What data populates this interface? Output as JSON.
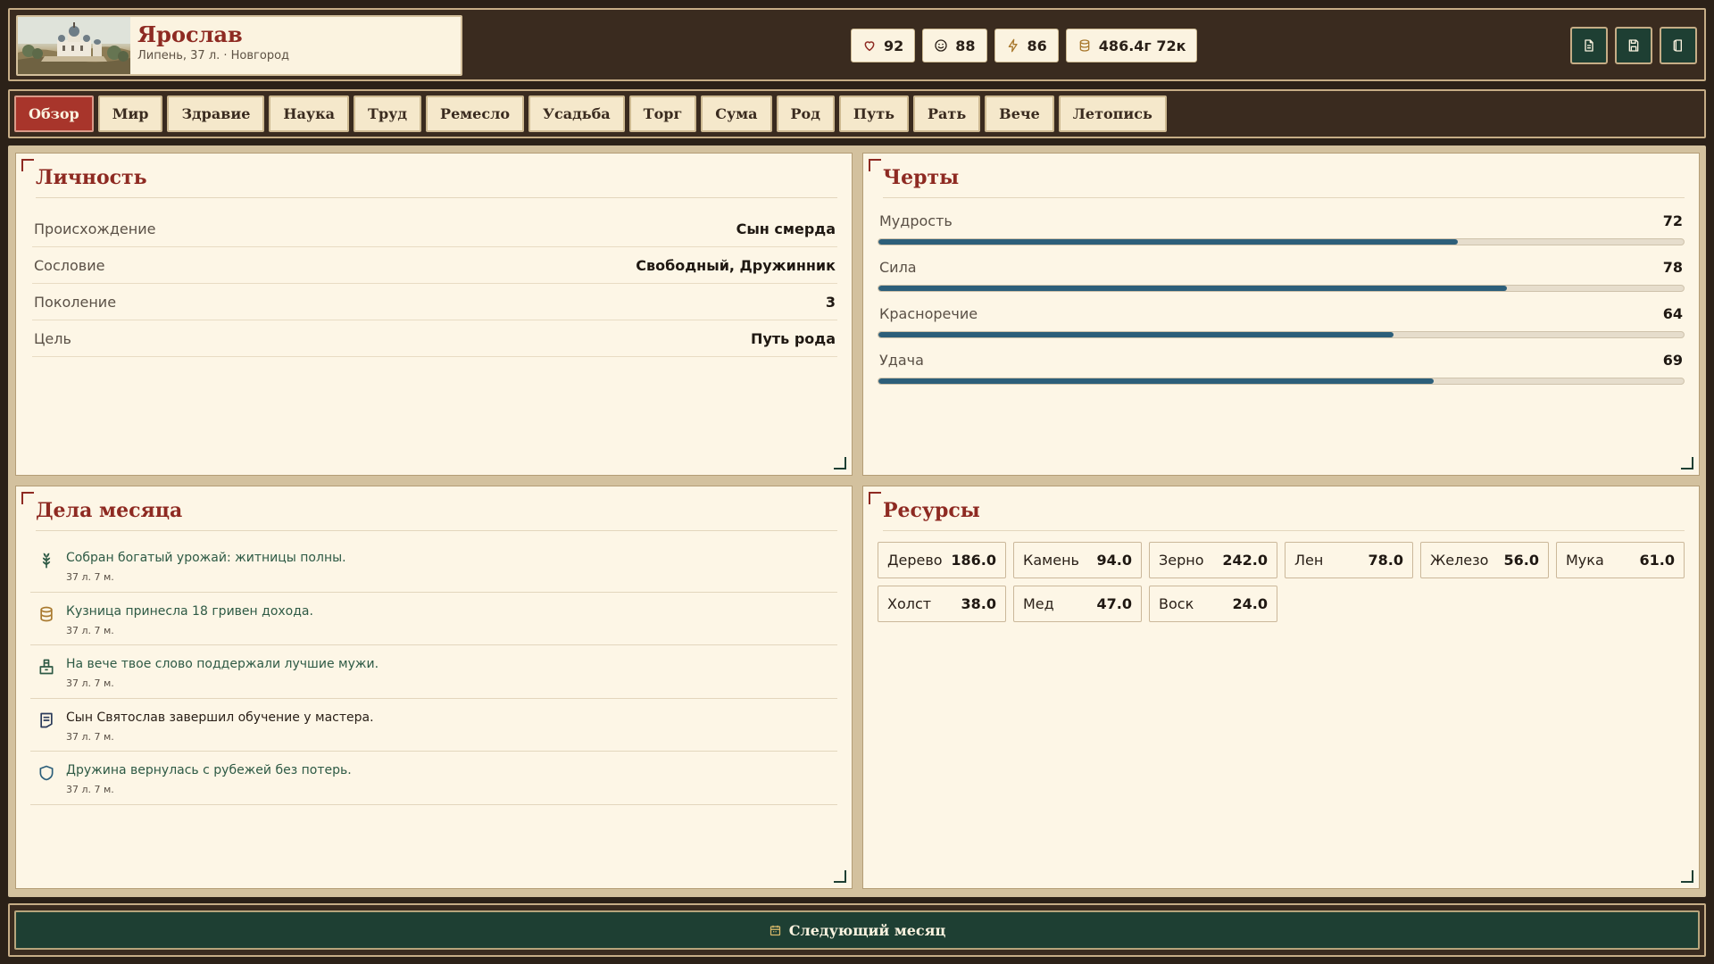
{
  "header": {
    "name": "Ярослав",
    "subtitle": "Липень, 37 л. · Новгород",
    "stats": [
      {
        "icon": "heart-icon",
        "value": "92"
      },
      {
        "icon": "smile-icon",
        "value": "88"
      },
      {
        "icon": "lightning-icon",
        "value": "86"
      },
      {
        "icon": "coins-icon",
        "value": "486.4г 72к"
      }
    ],
    "actions": [
      {
        "icon": "document-icon"
      },
      {
        "icon": "save-icon"
      },
      {
        "icon": "exit-icon"
      }
    ]
  },
  "tabs": [
    "Обзор",
    "Мир",
    "Здравие",
    "Наука",
    "Труд",
    "Ремесло",
    "Усадьба",
    "Торг",
    "Сума",
    "Род",
    "Путь",
    "Рать",
    "Вече",
    "Летопись"
  ],
  "active_tab": "Обзор",
  "personality": {
    "title": "Личность",
    "rows": [
      {
        "key": "Происхождение",
        "value": "Сын смерда"
      },
      {
        "key": "Сословие",
        "value": "Свободный, Дружинник"
      },
      {
        "key": "Поколение",
        "value": "3"
      },
      {
        "key": "Цель",
        "value": "Путь рода"
      }
    ]
  },
  "traits": {
    "title": "Черты",
    "items": [
      {
        "name": "Мудрость",
        "value": "72",
        "percent": 72
      },
      {
        "name": "Сила",
        "value": "78",
        "percent": 78
      },
      {
        "name": "Красноречие",
        "value": "64",
        "percent": 64
      },
      {
        "name": "Удача",
        "value": "69",
        "percent": 69
      }
    ],
    "bar_color": "#2d5f7a"
  },
  "deeds": {
    "title": "Дела месяца",
    "items": [
      {
        "icon": "wheat-icon",
        "text": "Собран богатый урожай: житницы полны.",
        "date": "37 л. 7 м.",
        "tone": "positive"
      },
      {
        "icon": "coins-icon",
        "text": "Кузница принесла 18 гривен дохода.",
        "date": "37 л. 7 м.",
        "tone": "positive"
      },
      {
        "icon": "ballot-icon",
        "text": "На вече твое слово поддержали лучшие мужи.",
        "date": "37 л. 7 м.",
        "tone": "positive"
      },
      {
        "icon": "scroll-icon",
        "text": "Сын Святослав завершил обучение у мастера.",
        "date": "37 л. 7 м.",
        "tone": "neutral"
      },
      {
        "icon": "shield-icon",
        "text": "Дружина вернулась с рубежей без потерь.",
        "date": "37 л. 7 м.",
        "tone": "positive"
      }
    ]
  },
  "resources": {
    "title": "Ресурсы",
    "items": [
      {
        "name": "Дерево",
        "value": "186.0"
      },
      {
        "name": "Камень",
        "value": "94.0"
      },
      {
        "name": "Зерно",
        "value": "242.0"
      },
      {
        "name": "Лен",
        "value": "78.0"
      },
      {
        "name": "Железо",
        "value": "56.0"
      },
      {
        "name": "Мука",
        "value": "61.0"
      },
      {
        "name": "Холст",
        "value": "38.0"
      },
      {
        "name": "Мед",
        "value": "47.0"
      },
      {
        "name": "Воск",
        "value": "24.0"
      }
    ]
  },
  "footer": {
    "next_label": "Следующий месяц",
    "icon": "calendar-icon"
  },
  "colors": {
    "accent_red": "#a8352b",
    "dark_green": "#1e3f33",
    "parchment": "#fdf6e6",
    "frame": "#3a2b1f"
  }
}
